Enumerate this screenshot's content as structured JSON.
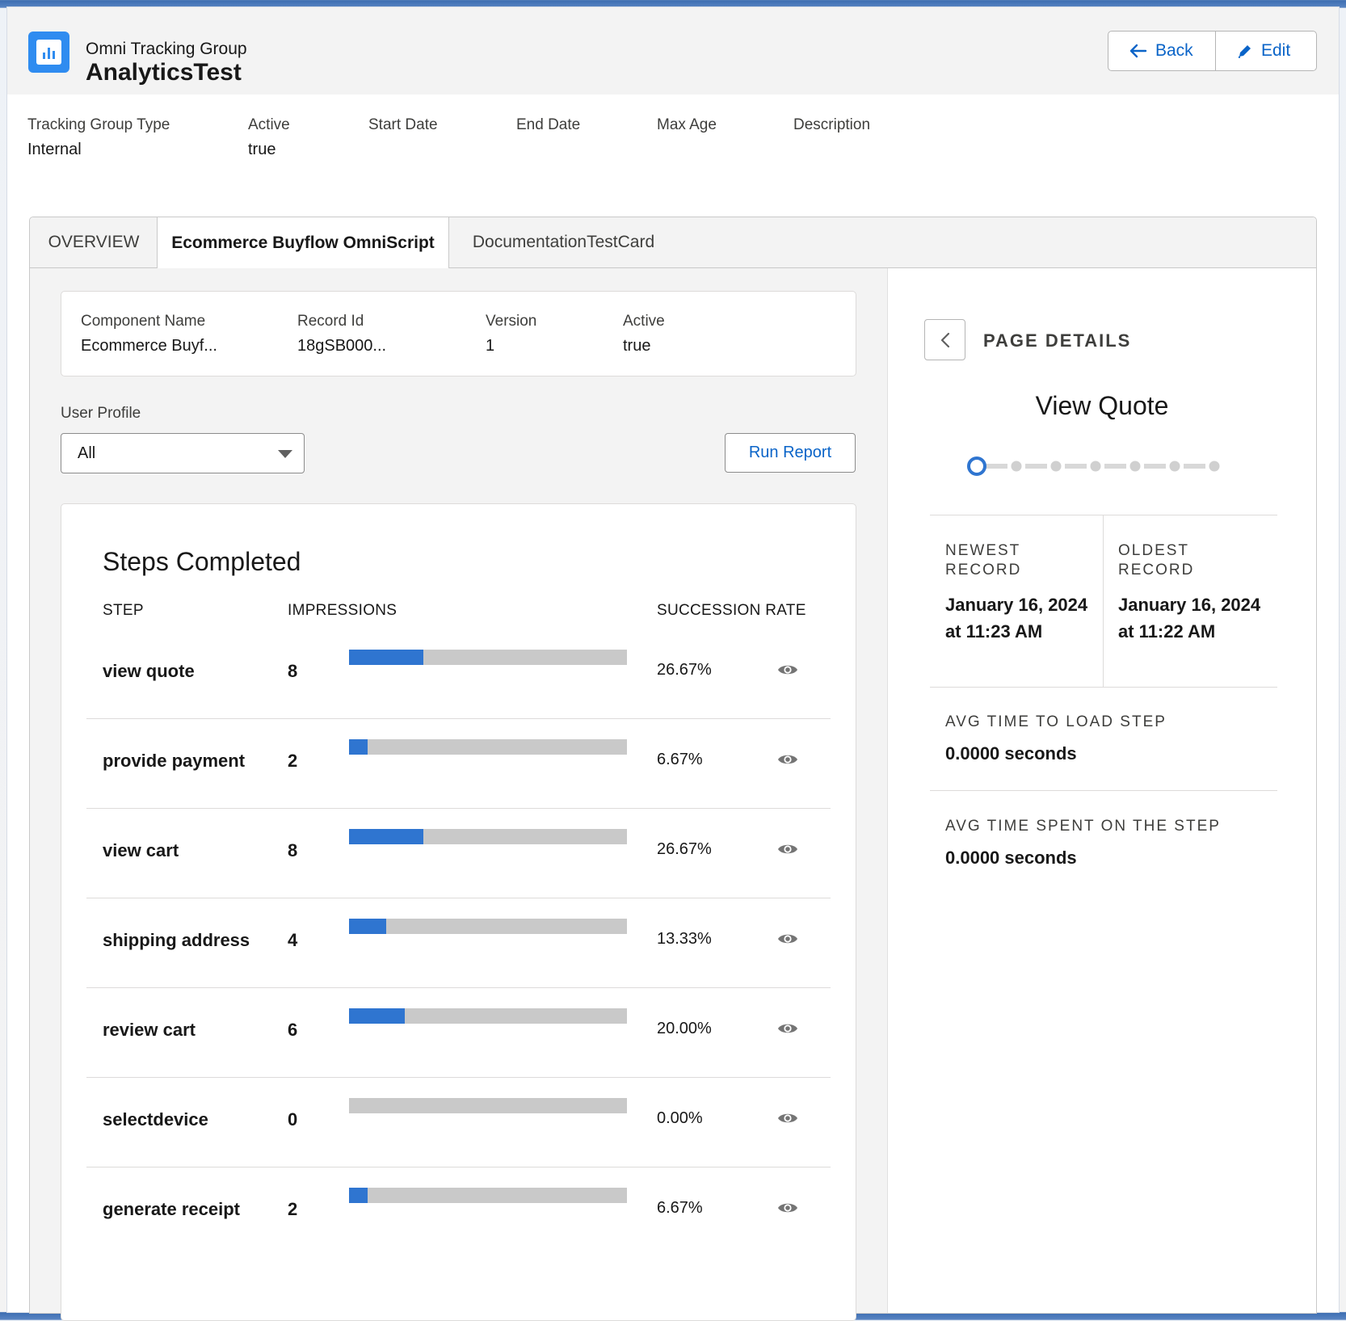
{
  "header": {
    "object_type": "Omni Tracking Group",
    "title": "AnalyticsTest",
    "buttons": {
      "back_label": "Back",
      "edit_label": "Edit"
    }
  },
  "fields": [
    {
      "label": "Tracking Group Type",
      "value": "Internal"
    },
    {
      "label": "Active",
      "value": "true"
    },
    {
      "label": "Start Date",
      "value": ""
    },
    {
      "label": "End Date",
      "value": ""
    },
    {
      "label": "Max Age",
      "value": ""
    },
    {
      "label": "Description",
      "value": ""
    }
  ],
  "tabs": [
    {
      "label": "OVERVIEW",
      "active": false
    },
    {
      "label": "Ecommerce Buyflow OmniScript",
      "active": true
    },
    {
      "label": "DocumentationTestCard",
      "active": false
    }
  ],
  "component": {
    "fields": [
      {
        "label": "Component Name",
        "value": "Ecommerce Buyf..."
      },
      {
        "label": "Record Id",
        "value": "18gSB000..."
      },
      {
        "label": "Version",
        "value": "1"
      },
      {
        "label": "Active",
        "value": "true"
      }
    ]
  },
  "filter": {
    "label": "User Profile",
    "selected": "All",
    "run_report_label": "Run Report"
  },
  "steps": {
    "title": "Steps Completed",
    "columns": {
      "step": "STEP",
      "impressions": "IMPRESSIONS",
      "rate": "SUCCESSION RATE"
    },
    "rows": [
      {
        "name": "view quote",
        "impressions": "8",
        "rate": "26.67%",
        "fraction": 0.2667
      },
      {
        "name": "provide payment",
        "impressions": "2",
        "rate": "6.67%",
        "fraction": 0.0667
      },
      {
        "name": "view cart",
        "impressions": "8",
        "rate": "26.67%",
        "fraction": 0.2667
      },
      {
        "name": "shipping address",
        "impressions": "4",
        "rate": "13.33%",
        "fraction": 0.1333
      },
      {
        "name": "review cart",
        "impressions": "6",
        "rate": "20.00%",
        "fraction": 0.2
      },
      {
        "name": "selectdevice",
        "impressions": "0",
        "rate": "0.00%",
        "fraction": 0.0
      },
      {
        "name": "generate receipt",
        "impressions": "2",
        "rate": "6.67%",
        "fraction": 0.0667
      }
    ]
  },
  "details": {
    "title": "PAGE DETAILS",
    "step_name": "View Quote",
    "progress": {
      "total_steps": 7,
      "current_step": 1
    },
    "newest": {
      "label": "NEWEST RECORD",
      "value": "January 16, 2024 at 11:23 AM"
    },
    "oldest": {
      "label": "OLDEST RECORD",
      "value": "January 16, 2024 at 11:22 AM"
    },
    "avg_load": {
      "label": "AVG TIME TO LOAD STEP",
      "value": "0.0000 seconds"
    },
    "avg_spent": {
      "label": "AVG TIME SPENT ON THE STEP",
      "value": "0.0000 seconds"
    }
  },
  "colors": {
    "accent": "#0a64c8",
    "bar_fill": "#2f75d0",
    "bar_track": "#c9c9c9",
    "app_icon": "#2f8cf0"
  },
  "icons": [
    "analytics-icon",
    "arrow-left-icon",
    "pencil-icon",
    "chevron-down-icon",
    "eye-icon",
    "chevron-left-icon"
  ]
}
